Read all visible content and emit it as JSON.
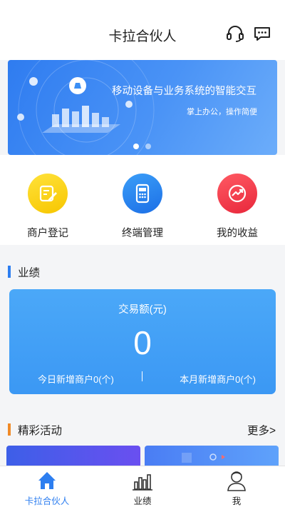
{
  "header": {
    "title": "卡拉合伙人",
    "icons": [
      "headset-icon",
      "chat-icon"
    ]
  },
  "banner": {
    "title": "移动设备与业务系统的智能交互",
    "subtitle": "掌上办公，操作简便",
    "slide_count": 2,
    "active_slide": 1
  },
  "quick_actions": [
    {
      "label": "商户登记",
      "icon": "edit-icon",
      "color": "#f7c600"
    },
    {
      "label": "终端管理",
      "icon": "pos-terminal-icon",
      "color": "#1c6fe6"
    },
    {
      "label": "我的收益",
      "icon": "trend-chart-icon",
      "color": "#e8273b"
    }
  ],
  "performance": {
    "section_title": "业绩",
    "label": "交易额(元)",
    "value": "0",
    "today_new": "今日新增商户0(个)",
    "separator": "I",
    "month_new": "本月新增商户0(个)"
  },
  "activities": {
    "section_title": "精彩活动",
    "more": "更多>"
  },
  "tabbar": {
    "items": [
      {
        "label": "卡拉合伙人",
        "icon": "home-icon",
        "active": true
      },
      {
        "label": "业绩",
        "icon": "bar-chart-icon",
        "active": false
      },
      {
        "label": "我",
        "icon": "user-icon",
        "active": false
      }
    ]
  },
  "colors": {
    "accent": "#2d7ef0",
    "activity_accent": "#f08a27"
  }
}
